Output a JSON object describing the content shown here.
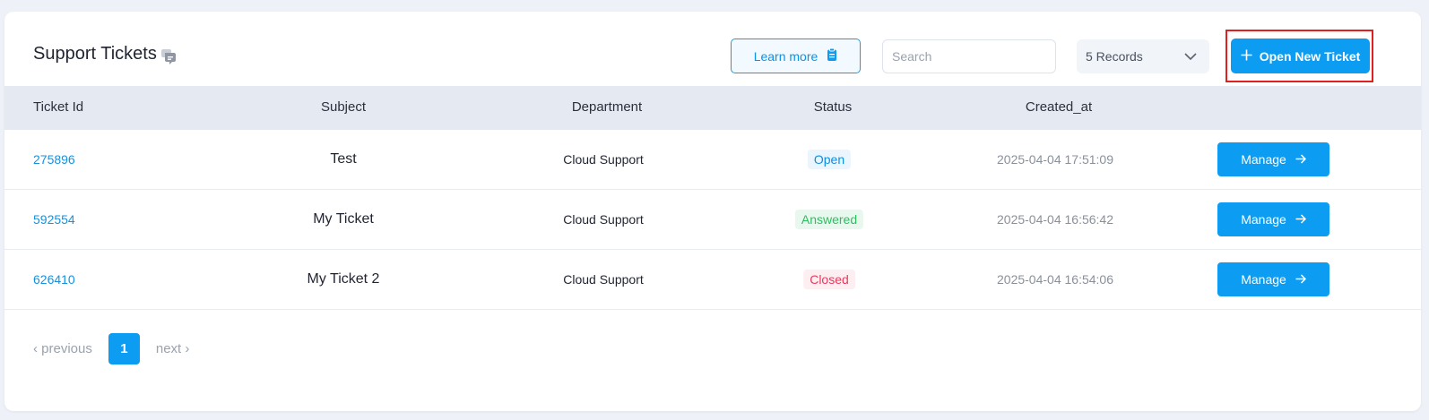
{
  "header": {
    "title": "Support Tickets",
    "learn_more_label": "Learn more",
    "search_placeholder": "Search",
    "records_selected": "5 Records",
    "open_new_ticket_label": "Open New Ticket"
  },
  "table": {
    "columns": [
      "Ticket Id",
      "Subject",
      "Department",
      "Status",
      "Created_at"
    ],
    "rows": [
      {
        "id": "275896",
        "subject": "Test",
        "department": "Cloud Support",
        "status": "Open",
        "created_at": "2025-04-04 17:51:09",
        "action": "Manage"
      },
      {
        "id": "592554",
        "subject": "My Ticket",
        "department": "Cloud Support",
        "status": "Answered",
        "created_at": "2025-04-04 16:56:42",
        "action": "Manage"
      },
      {
        "id": "626410",
        "subject": "My Ticket 2",
        "department": "Cloud Support",
        "status": "Closed",
        "created_at": "2025-04-04 16:54:06",
        "action": "Manage"
      }
    ]
  },
  "pagination": {
    "previous_label": "‹ previous",
    "current_page": "1",
    "next_label": "next ›"
  },
  "colors": {
    "accent": "#0c9cf2",
    "status_open": "#0c8fe0",
    "status_answered": "#2cbf5f",
    "status_closed": "#e83a5f",
    "highlight_outline": "#e02020"
  }
}
